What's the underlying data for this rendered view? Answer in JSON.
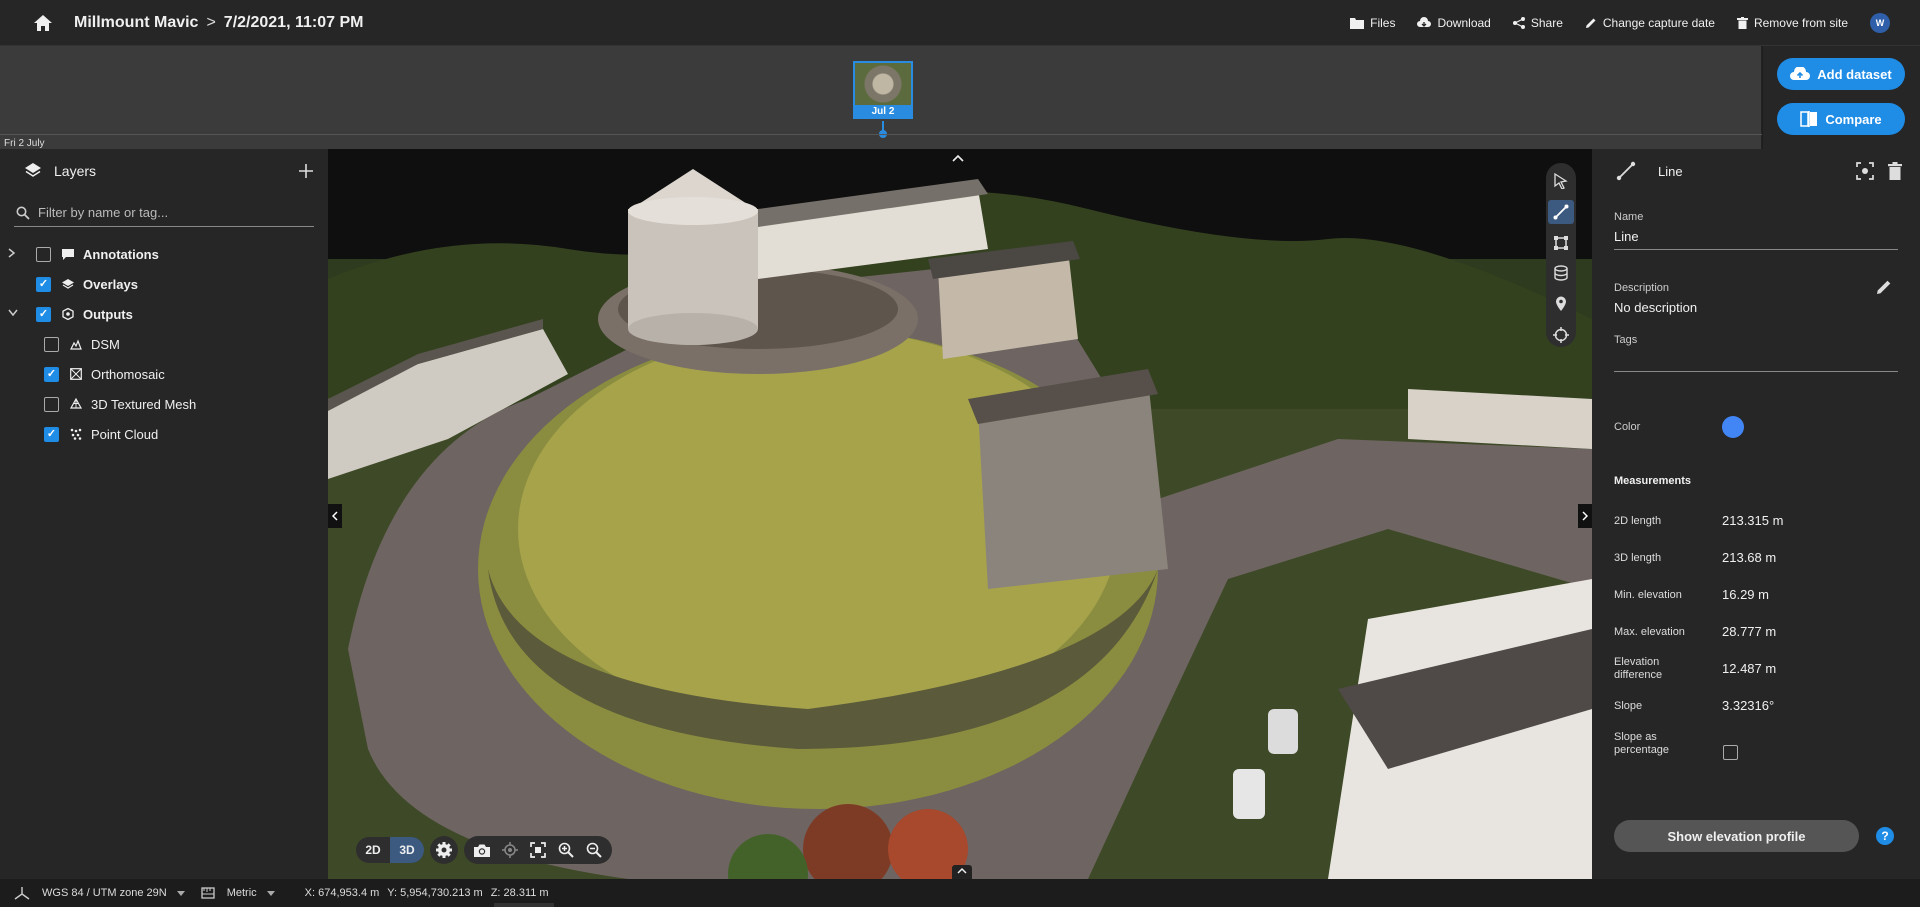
{
  "header": {
    "site_name": "Millmount Mavic",
    "separator": ">",
    "capture_date": "7/2/2021, 11:07 PM",
    "actions": [
      {
        "label": "Files",
        "icon": "folder-icon"
      },
      {
        "label": "Download",
        "icon": "cloud-download-icon"
      },
      {
        "label": "Share",
        "icon": "share-icon"
      },
      {
        "label": "Change capture date",
        "icon": "pencil-icon"
      },
      {
        "label": "Remove from site",
        "icon": "trash-icon"
      }
    ],
    "user_initial": "W"
  },
  "timeline": {
    "day_label": "Fri 2 July",
    "thumbnail_label": "Jul 2"
  },
  "primary_actions": {
    "add_dataset": "Add dataset",
    "compare": "Compare"
  },
  "layers": {
    "title": "Layers",
    "filter_placeholder": "Filter by name or tag...",
    "items": [
      {
        "label": "Annotations",
        "checked": false,
        "expandable": true,
        "expanded": false,
        "icon": "comment-icon"
      },
      {
        "label": "Overlays",
        "checked": true,
        "expandable": false,
        "icon": "layers-icon"
      },
      {
        "label": "Outputs",
        "checked": true,
        "expandable": true,
        "expanded": true,
        "icon": "outputs-icon"
      },
      {
        "label": "DSM",
        "checked": false,
        "icon": "dsm-icon"
      },
      {
        "label": "Orthomosaic",
        "checked": true,
        "icon": "orthomosaic-icon"
      },
      {
        "label": "3D Textured Mesh",
        "checked": false,
        "icon": "mesh-icon"
      },
      {
        "label": "Point Cloud",
        "checked": true,
        "icon": "point-cloud-icon"
      }
    ]
  },
  "viewer": {
    "mode_2d": "2D",
    "mode_3d": "3D",
    "active_mode": "3D",
    "tools": [
      "select-pointer-icon",
      "line-measure-icon",
      "area-measure-icon",
      "volume-measure-icon",
      "location-pin-icon",
      "crosshair-icon"
    ],
    "active_tool": "line-measure-icon"
  },
  "detail": {
    "type_title": "Line",
    "name_label": "Name",
    "name_value": "Line",
    "description_label": "Description",
    "description_value": "No description",
    "tags_label": "Tags",
    "color_label": "Color",
    "color_value": "#4285f4",
    "measurements_title": "Measurements",
    "measurements": [
      {
        "label": "2D length",
        "value": "213.315 m"
      },
      {
        "label": "3D length",
        "value": "213.68 m"
      },
      {
        "label": "Min. elevation",
        "value": "16.29 m"
      },
      {
        "label": "Max. elevation",
        "value": "28.777 m"
      },
      {
        "label": "Elevation difference",
        "value": "12.487 m"
      },
      {
        "label": "Slope",
        "value": "3.32316°"
      }
    ],
    "slope_pct_label": "Slope as percentage",
    "slope_pct_checked": false,
    "elevation_button": "Show elevation profile",
    "help": "?"
  },
  "statusbar": {
    "crs": "WGS 84 / UTM zone 29N",
    "units": "Metric",
    "x": "X: 674,953.4 m",
    "y": "Y: 5,954,730.213 m",
    "z": "Z: 28.311 m"
  }
}
